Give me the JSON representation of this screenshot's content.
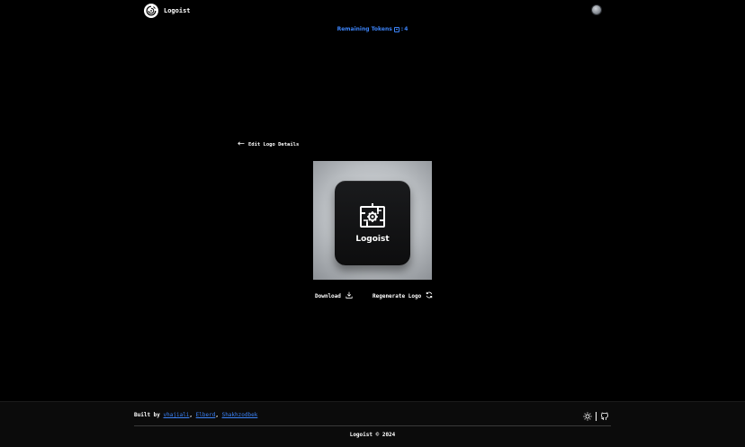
{
  "header": {
    "brand_name": "Logoist",
    "avatar_icon": "user-avatar"
  },
  "tokens": {
    "label": "Remaining Tokens",
    "icon": "token-icon",
    "separator": ":",
    "count": "4",
    "color": "#3b82f6"
  },
  "nav": {
    "back_label": "Edit Logo Details",
    "back_icon": "arrow-left-icon"
  },
  "logo_preview": {
    "wordmark": "Logoist",
    "icon": "gear-circuit-icon"
  },
  "actions": {
    "download_label": "Download",
    "download_icon": "download-icon",
    "regenerate_label": "Regenerate Logo",
    "regenerate_icon": "refresh-icon"
  },
  "footer": {
    "built_by_prefix": "Built by",
    "authors": [
      "vhajiali",
      "Elberd",
      "Shakhzodbek"
    ],
    "author_sep_1": ", ",
    "author_sep_2": ", ",
    "theme_icon": "sun-icon",
    "github_icon": "github-icon",
    "copyright": "Logoist © 2024"
  }
}
